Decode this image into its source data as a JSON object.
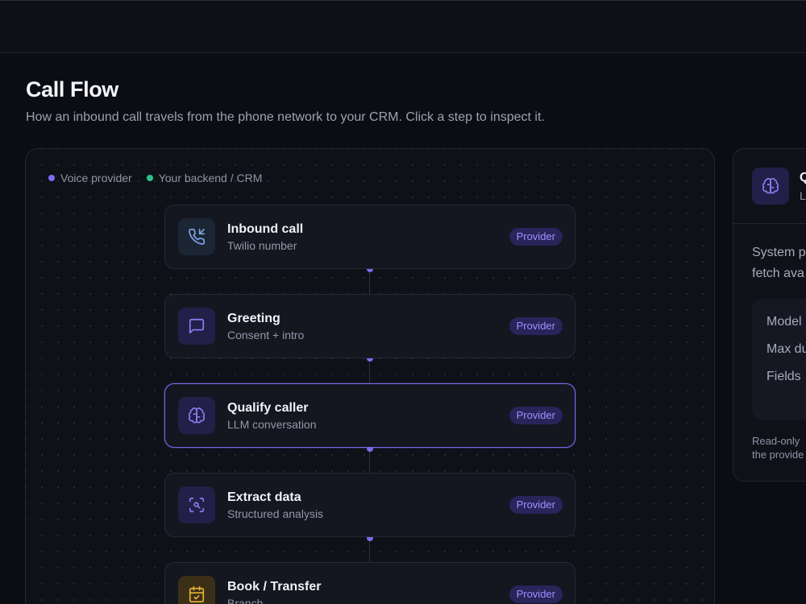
{
  "header": {
    "title": "Call Flow",
    "subtitle": "How an inbound call travels from the phone network to your CRM. Click a step to inspect it."
  },
  "legend": [
    {
      "label": "Voice provider",
      "color": "#7c6cf2"
    },
    {
      "label": "Your backend / CRM",
      "color": "#2ec28a"
    }
  ],
  "nodes": [
    {
      "title": "Inbound call",
      "subtitle": "Twilio number",
      "badge": "Provider",
      "icon": "phone-incoming-icon",
      "active": false
    },
    {
      "title": "Greeting",
      "subtitle": "Consent + intro",
      "badge": "Provider",
      "icon": "message-square-icon",
      "active": false
    },
    {
      "title": "Qualify caller",
      "subtitle": "LLM conversation",
      "badge": "Provider",
      "icon": "brain-icon",
      "active": true
    },
    {
      "title": "Extract data",
      "subtitle": "Structured analysis",
      "badge": "Provider",
      "icon": "scan-search-icon",
      "active": false
    },
    {
      "title": "Book / Transfer",
      "subtitle": "Branch",
      "badge": "Provider",
      "icon": "calendar-check-icon",
      "active": false
    }
  ],
  "panel": {
    "title": "Q",
    "subtitle": "L",
    "text_line1": "System p",
    "text_line2": "fetch ava",
    "props": [
      "Model",
      "Max du",
      "Fields"
    ],
    "note_line1": "Read-only",
    "note_line2": "the provide",
    "icon": "brain-icon"
  },
  "colors": {
    "accent": "#7769e6",
    "provider": "#7c6cf2",
    "backend": "#2ec28a",
    "badge_bg": "#29245a",
    "badge_text": "#9d93ff"
  }
}
